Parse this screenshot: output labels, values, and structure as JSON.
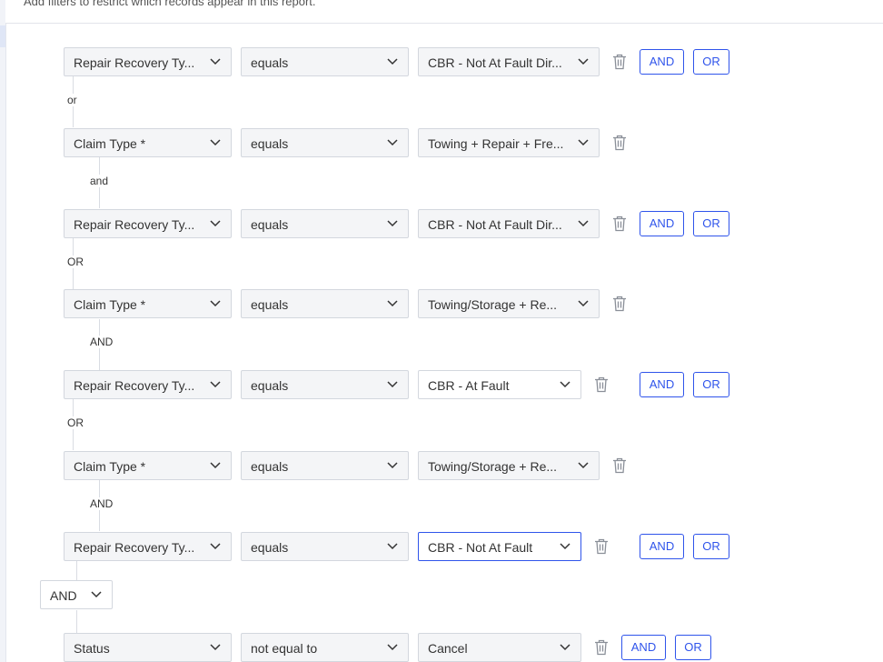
{
  "header": {
    "subtitle": "Add filters to restrict which records appear in this report."
  },
  "rows": [
    {
      "field": "Repair Recovery Ty...",
      "operator": "equals",
      "value": "CBR - Not At Fault Dir..."
    },
    {
      "field": "Claim Type *",
      "operator": "equals",
      "value": "Towing + Repair + Fre..."
    },
    {
      "field": "Repair Recovery Ty...",
      "operator": "equals",
      "value": "CBR - Not At Fault Dir..."
    },
    {
      "field": "Claim Type *",
      "operator": "equals",
      "value": "Towing/Storage + Re..."
    },
    {
      "field": "Repair Recovery Ty...",
      "operator": "equals",
      "value": "CBR - At Fault"
    },
    {
      "field": "Claim Type *",
      "operator": "equals",
      "value": "Towing/Storage + Re..."
    },
    {
      "field": "Repair Recovery Ty...",
      "operator": "equals",
      "value": "CBR - Not At Fault"
    },
    {
      "field": "Status",
      "operator": "not equal to",
      "value": "Cancel"
    }
  ],
  "connectors": [
    "or",
    "and",
    "OR",
    "AND",
    "OR",
    "AND"
  ],
  "group_connector": "AND",
  "buttons": {
    "and": "AND",
    "or": "OR"
  },
  "icons": {
    "chevron": "chevron-down-icon",
    "delete": "trash-icon"
  }
}
